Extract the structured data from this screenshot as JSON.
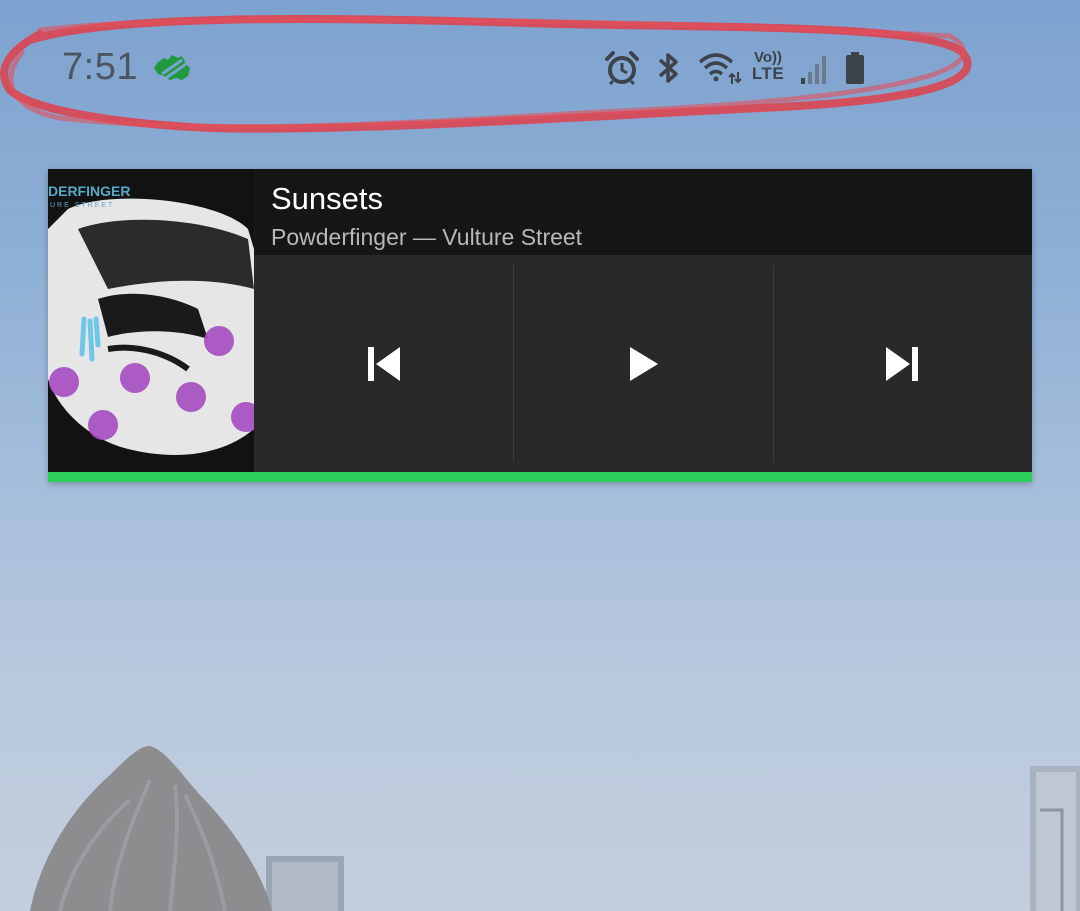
{
  "status_bar": {
    "time": "7:51",
    "app_icon": "australia-map-icon",
    "icons": [
      "alarm-icon",
      "bluetooth-icon",
      "wifi-icon",
      "volte-lte-icon",
      "signal-icon",
      "battery-icon"
    ],
    "volte_label": "Vo))",
    "lte_label": "LTE"
  },
  "media_notification": {
    "track_title": "Sunsets",
    "artist_album": "Powderfinger — Vulture Street",
    "album_art_text": {
      "band": "DERFINGER",
      "album": "URE STREET"
    },
    "controls": {
      "previous": "previous-track-icon",
      "play": "play-icon",
      "next": "next-track-icon"
    },
    "progress": 1.0,
    "accent_color": "#2dcf5b"
  },
  "annotation": {
    "color": "#e0404a"
  }
}
